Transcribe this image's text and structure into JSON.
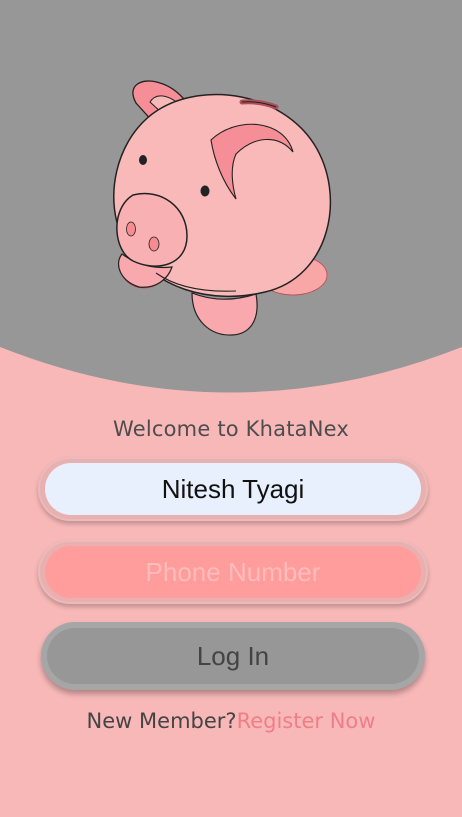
{
  "colors": {
    "background": "#f8b8b8",
    "header_gray": "#979797",
    "accent_pink": "#ef7f86",
    "name_field": "#e8f0fe",
    "phone_field": "#ff9c9c",
    "button_gray": "#979797"
  },
  "illustration": {
    "icon": "piggy-bank-icon"
  },
  "welcome_text": "Welcome to KhataNex",
  "form": {
    "name_value": "Nitesh Tyagi",
    "phone_placeholder": "Phone Number",
    "login_label": "Log In"
  },
  "footer": {
    "prompt": "New Member?",
    "register_link": "Register Now"
  }
}
